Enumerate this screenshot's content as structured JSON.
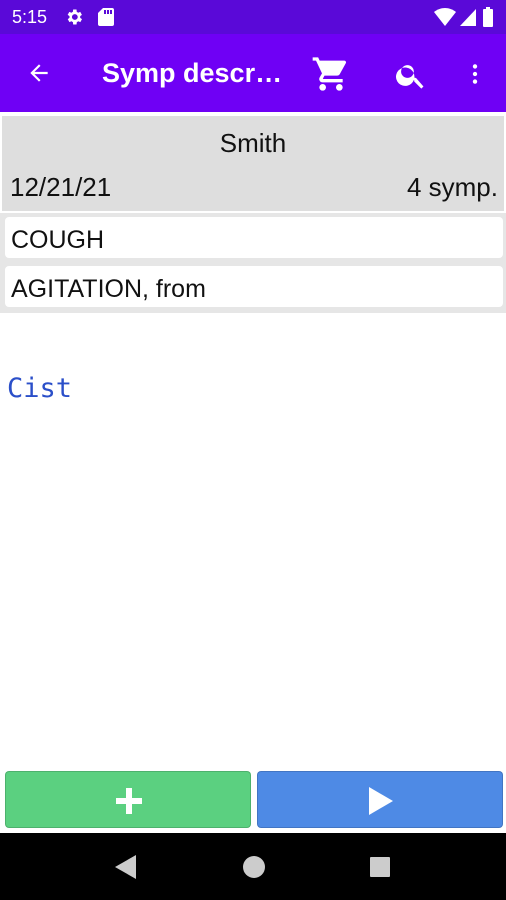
{
  "status_bar": {
    "time": "5:15",
    "icons": [
      "gear-icon",
      "sd-card-icon",
      "wifi-icon",
      "signal-icon",
      "battery-icon"
    ]
  },
  "app_bar": {
    "title": "Symp descri…",
    "icons": [
      "back-arrow-icon",
      "cart-icon",
      "search-icon",
      "more-vert-icon"
    ]
  },
  "header": {
    "name": "Smith",
    "date": "12/21/21",
    "count": "4 symp."
  },
  "symptoms": [
    {
      "label": "COUGH"
    },
    {
      "label": "AGITATION, from"
    }
  ],
  "note": "Cist",
  "actions": {
    "add_icon": "plus-icon",
    "play_icon": "play-icon"
  },
  "nav_bar": {
    "icons": [
      "back-triangle-icon",
      "home-circle-icon",
      "recents-square-icon"
    ]
  },
  "colors": {
    "status_bar": "#5a09d8",
    "app_bar": "#6f00f5",
    "add_button": "#5bd080",
    "play_button": "#4e8ae5",
    "note_text": "#2b4fc9",
    "header_card": "#dedede"
  }
}
